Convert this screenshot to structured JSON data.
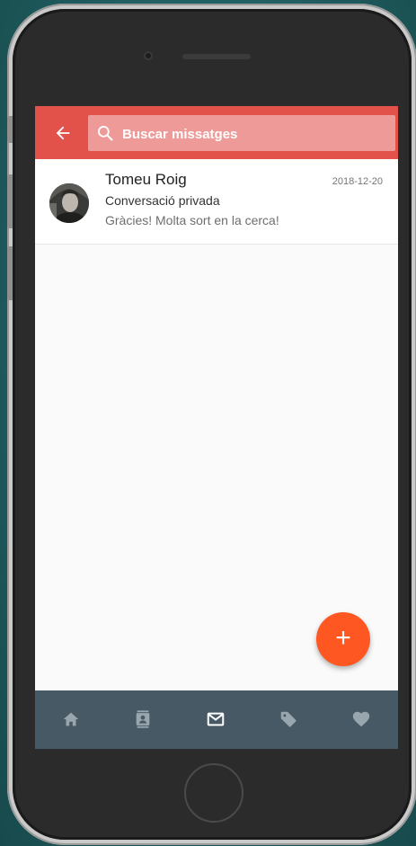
{
  "search": {
    "placeholder": "Buscar missatges"
  },
  "messages": [
    {
      "sender": "Tomeu Roig",
      "date": "2018-12-20",
      "subject": "Conversació privada",
      "snippet": "Gràcies! Molta sort en la cerca!"
    }
  ],
  "fab": {
    "label": "+"
  },
  "nav": {
    "items": [
      {
        "icon": "home-icon",
        "active": false
      },
      {
        "icon": "contacts-icon",
        "active": false
      },
      {
        "icon": "mail-icon",
        "active": true
      },
      {
        "icon": "tag-icon",
        "active": false
      },
      {
        "icon": "heart-icon",
        "active": false
      }
    ]
  },
  "colors": {
    "appbar": "#e2514a",
    "search_bg": "#ee9a98",
    "fab": "#ff5722",
    "bottom_nav": "#475965",
    "nav_icon": "#9aa6ae",
    "nav_icon_active": "#ffffff"
  }
}
